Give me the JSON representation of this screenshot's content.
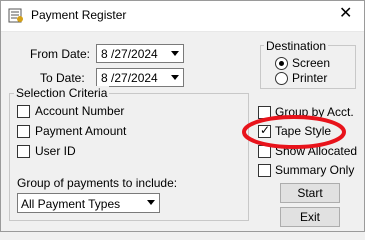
{
  "window": {
    "title": "Payment Register",
    "close_glyph": "✕"
  },
  "dates": {
    "from_label": "From Date:",
    "from_value": "8 /27/2024",
    "to_label": "To Date:",
    "to_value": "8 /27/2024"
  },
  "selection": {
    "title": "Selection Criteria",
    "items": [
      {
        "label": "Account Number",
        "checked": false
      },
      {
        "label": "Payment Amount",
        "checked": false
      },
      {
        "label": "User ID",
        "checked": false
      }
    ],
    "group_label": "Group of payments to include:",
    "group_value": "All Payment Types"
  },
  "destination": {
    "title": "Destination",
    "options": [
      {
        "label": "Screen",
        "selected": true
      },
      {
        "label": "Printer",
        "selected": false
      }
    ]
  },
  "options": [
    {
      "label": "Group by Acct.",
      "checked": false
    },
    {
      "label": "Tape Style",
      "checked": true,
      "check_glyph": "✓"
    },
    {
      "label": "Show Allocated",
      "checked": false
    },
    {
      "label": "Summary Only",
      "checked": false
    }
  ],
  "buttons": {
    "start": "Start",
    "exit": "Exit"
  },
  "colors": {
    "annotation": "#e8131b",
    "background": "#f0f0f0"
  }
}
